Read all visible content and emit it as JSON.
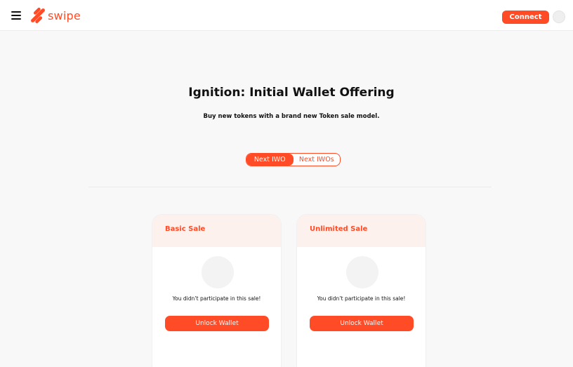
{
  "header": {
    "brand": "swipe",
    "connect_label": "Connect",
    "brand_color": "#ff4b26",
    "icons": [
      "menu-icon",
      "swipe-logo-icon",
      "avatar"
    ]
  },
  "hero": {
    "title": "Ignition: Initial Wallet Offering",
    "subtitle": "Buy new tokens with a brand new Token sale model."
  },
  "toggle": {
    "options": [
      {
        "label": "Next IWO",
        "active": true
      },
      {
        "label": "Next IWOs",
        "active": false
      }
    ]
  },
  "cards": [
    {
      "title": "Basic Sale",
      "message": "You didn’t participate in this sale!",
      "button_label": "Unlock Wallet"
    },
    {
      "title": "Unlimited Sale",
      "message": "You didn’t participate in this sale!",
      "button_label": "Unlock Wallet"
    }
  ]
}
